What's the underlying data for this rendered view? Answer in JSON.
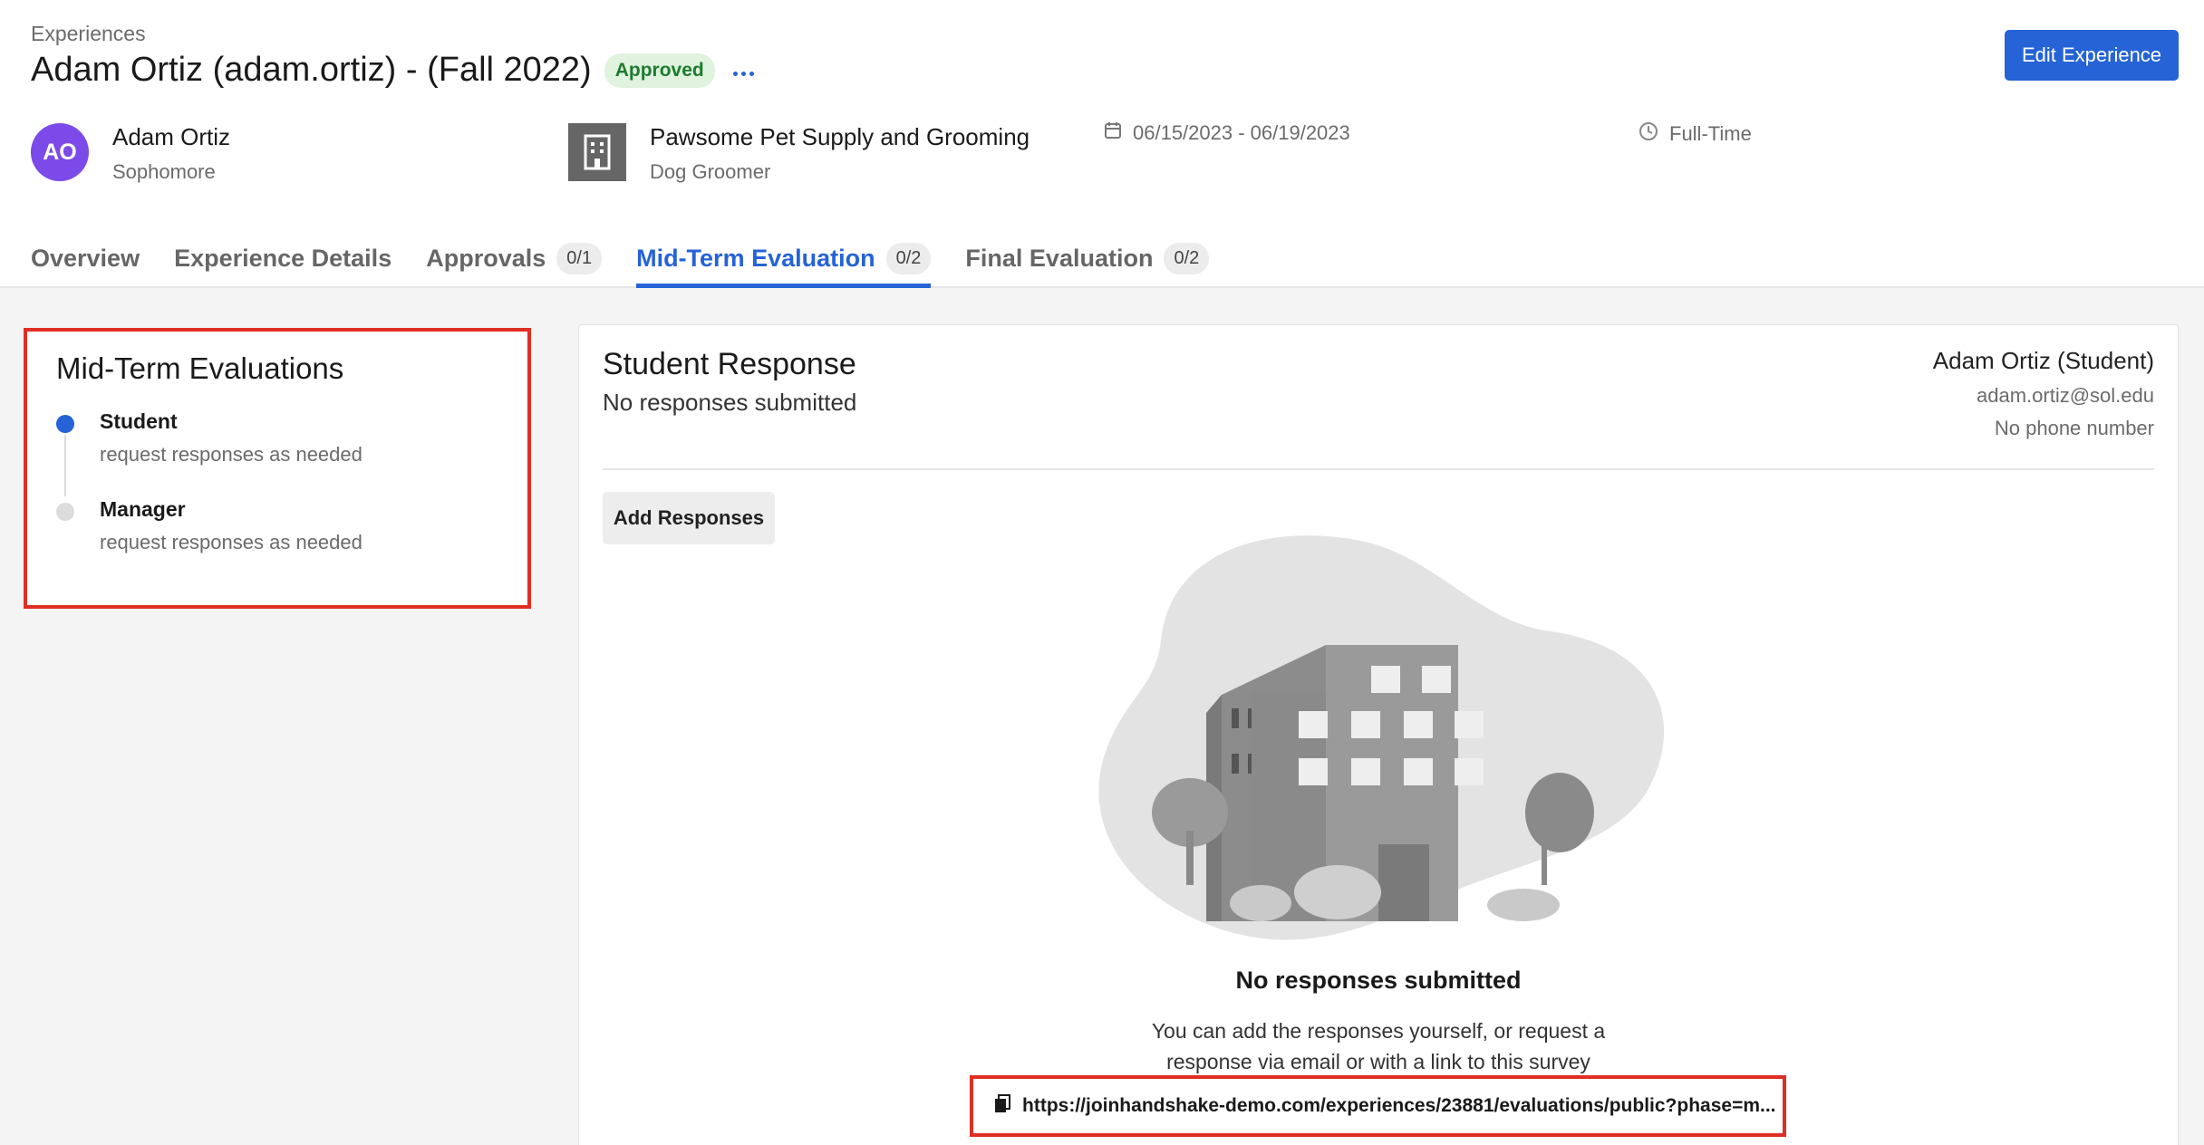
{
  "header": {
    "breadcrumb": "Experiences",
    "title": "Adam Ortiz (adam.ortiz) - (Fall 2022)",
    "status_badge": "Approved",
    "edit_button_label": "Edit Experience"
  },
  "student": {
    "initials": "AO",
    "name": "Adam Ortiz",
    "year": "Sophomore"
  },
  "employer": {
    "name": "Pawsome Pet Supply and Grooming",
    "role": "Dog Groomer"
  },
  "dates": "06/15/2023 - 06/19/2023",
  "employment_type": "Full-Time",
  "tabs": [
    {
      "label": "Overview",
      "count": ""
    },
    {
      "label": "Experience Details",
      "count": ""
    },
    {
      "label": "Approvals",
      "count": "0/1"
    },
    {
      "label": "Mid-Term Evaluation",
      "count": "0/2"
    },
    {
      "label": "Final Evaluation",
      "count": "0/2"
    }
  ],
  "evaluations": {
    "title": "Mid-Term Evaluations",
    "steps": [
      {
        "name": "Student",
        "status": "request responses as needed"
      },
      {
        "name": "Manager",
        "status": "request responses as needed"
      }
    ]
  },
  "response": {
    "title": "Student Response",
    "status": "No responses submitted",
    "contact_name": "Adam Ortiz (Student)",
    "contact_email": "adam.ortiz@sol.edu",
    "contact_phone": "No phone number",
    "add_button_label": "Add Responses",
    "empty_title": "No responses submitted",
    "empty_desc_line1": "You can add the responses yourself, or request a",
    "empty_desc_line2": "response via email or with a link to this survey",
    "survey_link": "https://joinhandshake-demo.com/experiences/23881/evaluations/public?phase=m..."
  },
  "colors": {
    "accent": "#2563d6",
    "highlight_border": "#e02e24",
    "avatar": "#7c4ae8",
    "approved_bg": "#dff3df",
    "approved_text": "#1e7b2e"
  }
}
